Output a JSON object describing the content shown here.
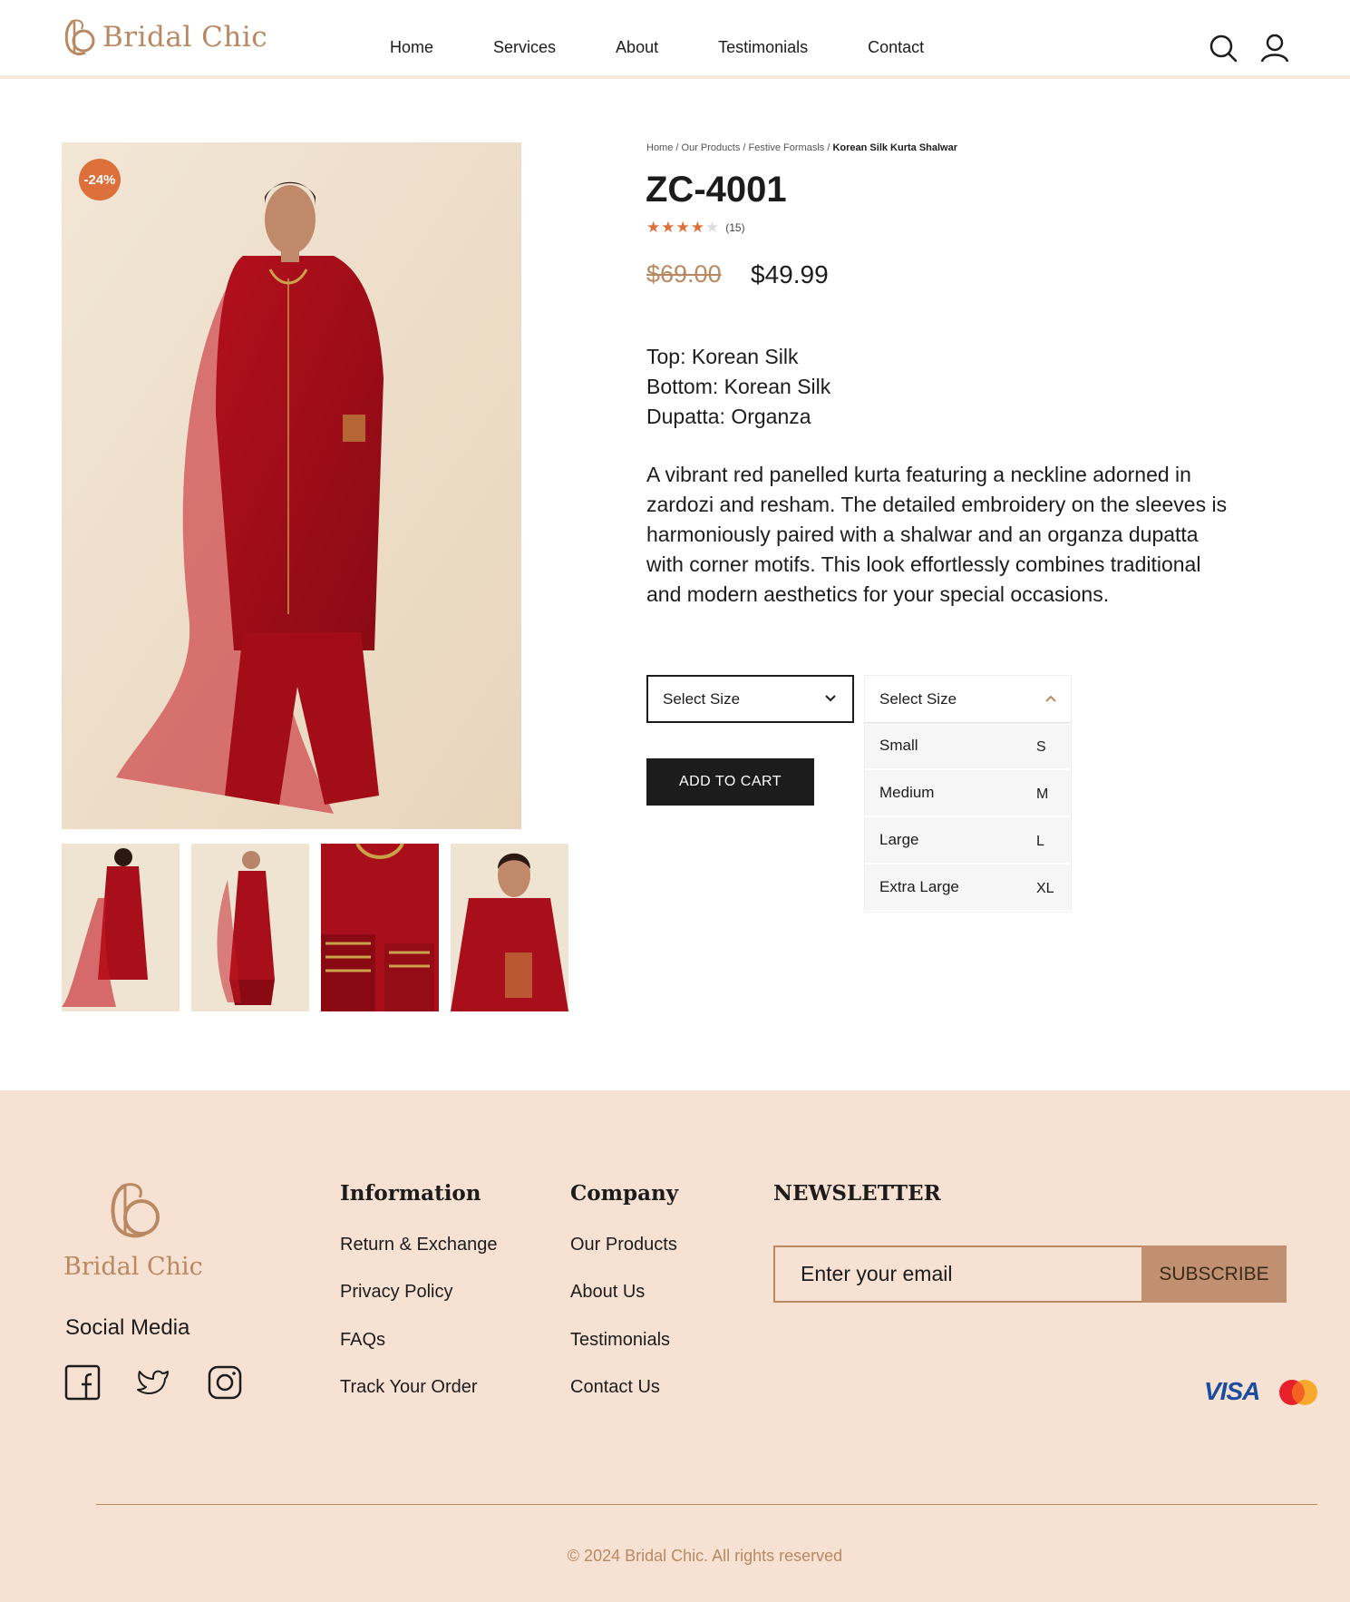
{
  "brand": {
    "name": "Bridal Chic"
  },
  "nav": {
    "items": [
      "Home",
      "Services",
      "About",
      "Testimonials",
      "Contact"
    ]
  },
  "product": {
    "discount_badge": "-24%",
    "breadcrumb": [
      "Home",
      "Our Products",
      "Festive Formasls",
      "Korean Silk Kurta Shalwar"
    ],
    "title": "ZC-4001",
    "rating": 4,
    "rating_max": 5,
    "review_count": "(15)",
    "old_price": "$69.00",
    "new_price": "$49.99",
    "specs": [
      "Top: Korean Silk",
      "Bottom: Korean Silk",
      "Dupatta: Organza"
    ],
    "description": "A vibrant red panelled kurta featuring a neckline adorned in zardozi and resham. The detailed embroidery on the sleeves is harmoniously paired with a shalwar and an organza dupatta with corner motifs. This look effortlessly combines traditional and modern aesthetics for your special occasions.",
    "size_placeholder": "Select Size",
    "add_to_cart": "ADD TO CART",
    "sizes": [
      {
        "label": "Small",
        "code": "S"
      },
      {
        "label": "Medium",
        "code": "M"
      },
      {
        "label": "Large",
        "code": "L"
      },
      {
        "label": "Extra Large",
        "code": "XL"
      }
    ]
  },
  "footer": {
    "logo_text": "Bridal Chic",
    "social_title": "Social Media",
    "social_icons": [
      "facebook-icon",
      "twitter-icon",
      "instagram-icon"
    ],
    "information": {
      "title": "Information",
      "links": [
        "Return & Exchange",
        "Privacy Policy",
        "FAQs",
        "Track Your Order"
      ]
    },
    "company": {
      "title": "Company",
      "links": [
        "Our Products",
        "About Us",
        "Testimonials",
        "Contact Us"
      ]
    },
    "newsletter": {
      "title": "NEWSLETTER",
      "placeholder": "Enter your email",
      "button": "SUBSCRIBE"
    },
    "payment": {
      "visa": "VISA",
      "mastercard": "MasterCard"
    },
    "copyright": "© 2024 Bridal Chic. All rights reserved"
  },
  "colors": {
    "accent": "#b98962",
    "badge": "#dd6f3a",
    "footer_bg": "#f6e1d3",
    "dark": "#1c1c1c"
  }
}
